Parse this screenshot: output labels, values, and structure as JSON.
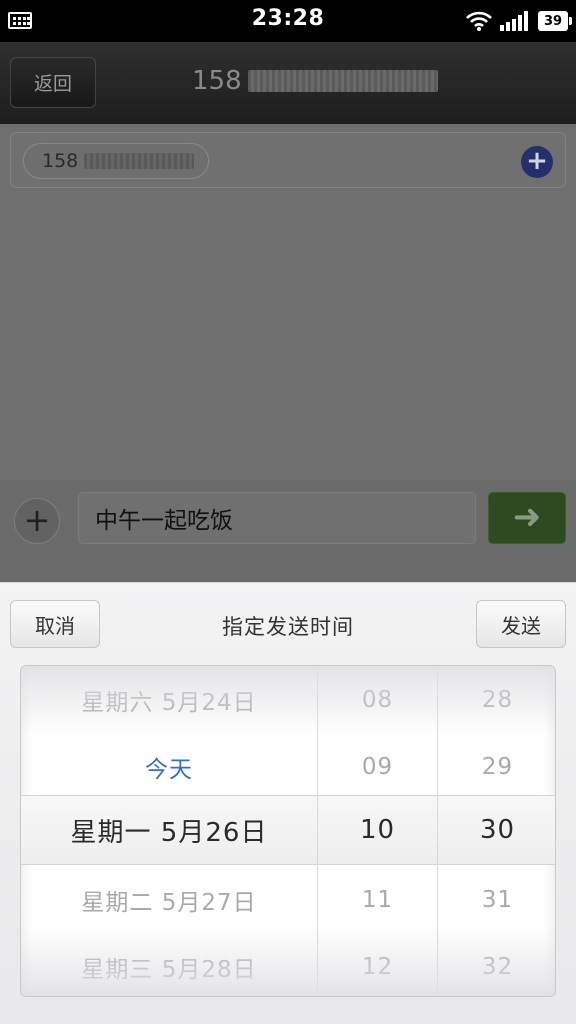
{
  "status_bar": {
    "time": "23:28",
    "battery": "39"
  },
  "app": {
    "back_label": "返回",
    "title_number": "158",
    "recipient_chip": "158",
    "message_text": "中午一起吃饭"
  },
  "picker": {
    "cancel_label": "取消",
    "title": "指定发送时间",
    "send_label": "发送",
    "dates": [
      "星期六  5月24日",
      "今天",
      "星期一  5月26日",
      "星期二  5月27日",
      "星期三  5月28日"
    ],
    "hours": [
      "08",
      "09",
      "10",
      "11",
      "12"
    ],
    "minutes": [
      "28",
      "29",
      "30",
      "31",
      "32"
    ],
    "selected": {
      "date": "星期一  5月26日",
      "hour": "10",
      "minute": "30"
    }
  },
  "colors": {
    "today": "#3a6fbf",
    "send_button": "#3a7a2a",
    "add_contact": "#2a3fa0"
  }
}
